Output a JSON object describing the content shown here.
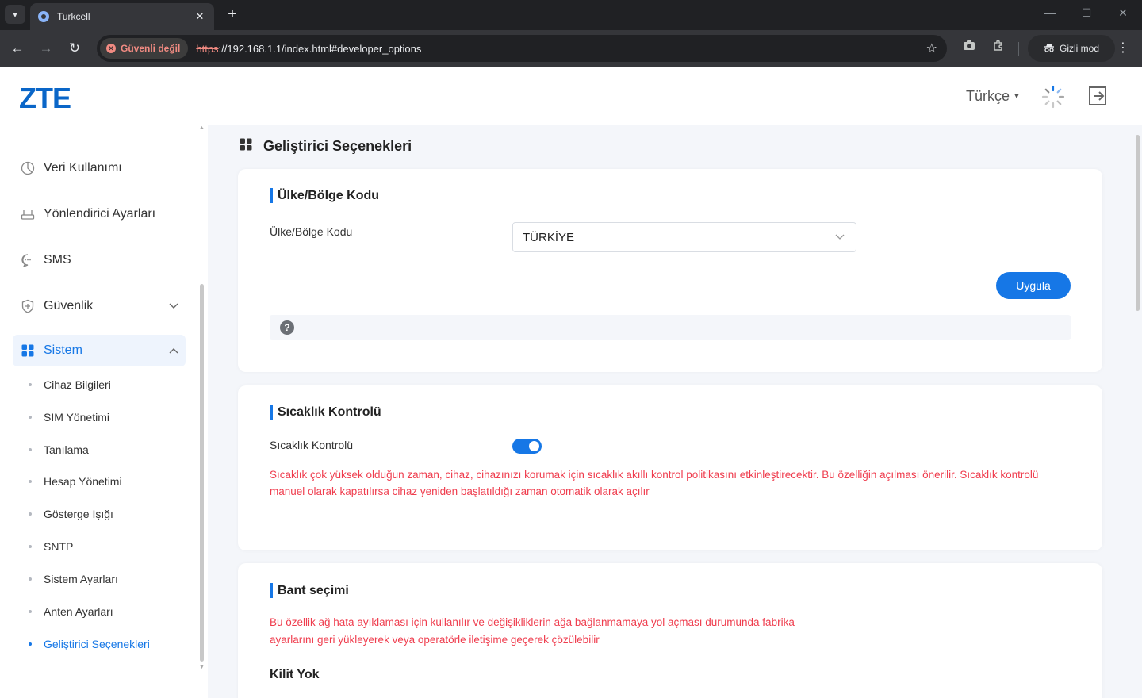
{
  "browser": {
    "tab_title": "Turkcell",
    "not_secure_label": "Güvenli değil",
    "url_scheme": "https",
    "url_rest": "://192.168.1.1/index.html#developer_options",
    "incognito_label": "Gizli mod"
  },
  "header": {
    "logo": "ZTE",
    "language": "Türkçe"
  },
  "sidebar": {
    "items": [
      {
        "label": "Veri Kullanımı",
        "icon": "pie-chart-icon"
      },
      {
        "label": "Yönlendirici Ayarları",
        "icon": "router-icon"
      },
      {
        "label": "SMS",
        "icon": "message-icon"
      },
      {
        "label": "Güvenlik",
        "icon": "shield-icon"
      },
      {
        "label": "Sistem",
        "icon": "grid-icon"
      }
    ],
    "sub_items": [
      "Cihaz Bilgileri",
      "SIM Yönetimi",
      "Tanılama",
      "Hesap Yönetimi",
      "Gösterge Işığı",
      "SNTP",
      "Sistem Ayarları",
      "Anten Ayarları",
      "Geliştirici Seçenekleri"
    ],
    "active_sub_item": "Geliştirici Seçenekleri"
  },
  "main": {
    "page_title": "Geliştirici Seçenekleri",
    "country_card": {
      "title": "Ülke/Bölge Kodu",
      "field_label": "Ülke/Bölge Kodu",
      "selected_value": "TÜRKİYE",
      "apply_label": "Uygula"
    },
    "temperature_card": {
      "title": "Sıcaklık Kontrolü",
      "field_label": "Sıcaklık Kontrolü",
      "toggle_on": true,
      "warning_line1": "Sıcaklık çok yüksek olduğun zaman, cihaz, cihazınızı korumak için sıcaklık akıllı kontrol politikasını etkinleştirecektir. Bu özelliğin açılması önerilir. Sıcaklık kontrolü",
      "warning_line2": "manuel olarak kapatılırsa cihaz yeniden başlatıldığı zaman otomatik olarak açılır"
    },
    "band_card": {
      "title": "Bant seçimi",
      "warning_line1": "Bu özellik ağ hata ayıklaması için kullanılır ve değişikliklerin ağa bağlanmamaya yol açması durumunda fabrika",
      "warning_line2": "ayarlarını geri yükleyerek veya operatörle iletişime geçerek çözülebilir",
      "lock_status": "Kilit Yok"
    }
  },
  "colors": {
    "accent": "#1677e6",
    "warning": "#ef3d4e",
    "brand": "#0a66c8"
  }
}
